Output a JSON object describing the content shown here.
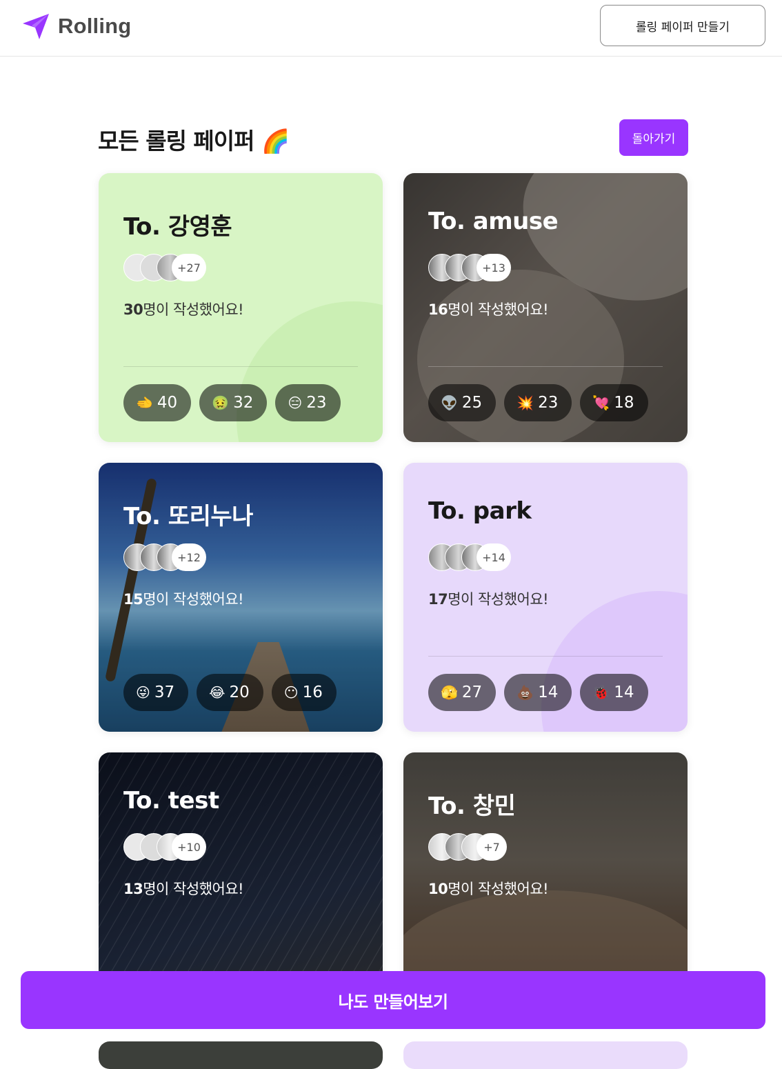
{
  "header": {
    "logo_text": "Rolling",
    "create_button": "롤링 페이퍼 만들기"
  },
  "page": {
    "title": "모든 롤링 페이퍼 🌈",
    "back_button": "돌아가기"
  },
  "cards": [
    {
      "to": "To. 강영훈",
      "more": "+27",
      "count": "30",
      "count_suffix": "명이 작성했어요!",
      "reactions": [
        {
          "emoji": "🫲",
          "count": "40"
        },
        {
          "emoji": "🤢",
          "count": "32"
        },
        {
          "emoji": "😑",
          "count": "23"
        }
      ]
    },
    {
      "to": "To. amuse",
      "more": "+13",
      "count": "16",
      "count_suffix": "명이 작성했어요!",
      "reactions": [
        {
          "emoji": "👽",
          "count": "25"
        },
        {
          "emoji": "💥",
          "count": "23"
        },
        {
          "emoji": "💘",
          "count": "18"
        }
      ]
    },
    {
      "to": "To. 또리누나",
      "more": "+12",
      "count": "15",
      "count_suffix": "명이 작성했어요!",
      "reactions": [
        {
          "emoji": "😜",
          "count": "37"
        },
        {
          "emoji": "😂",
          "count": "20"
        },
        {
          "emoji": "😶",
          "count": "16"
        }
      ]
    },
    {
      "to": "To. park",
      "more": "+14",
      "count": "17",
      "count_suffix": "명이 작성했어요!",
      "reactions": [
        {
          "emoji": "🫣",
          "count": "27"
        },
        {
          "emoji": "💩",
          "count": "14"
        },
        {
          "emoji": "🐞",
          "count": "14"
        }
      ]
    },
    {
      "to": "To. test",
      "more": "+10",
      "count": "13",
      "count_suffix": "명이 작성했어요!",
      "reactions": []
    },
    {
      "to": "To. 창민",
      "more": "+7",
      "count": "10",
      "count_suffix": "명이 작성했어요!",
      "reactions": []
    }
  ],
  "cta": {
    "label": "나도 만들어보기"
  },
  "colors": {
    "accent": "#9935ff",
    "green_card": "#d8f5c5",
    "purple_card": "#e7d9fb"
  }
}
